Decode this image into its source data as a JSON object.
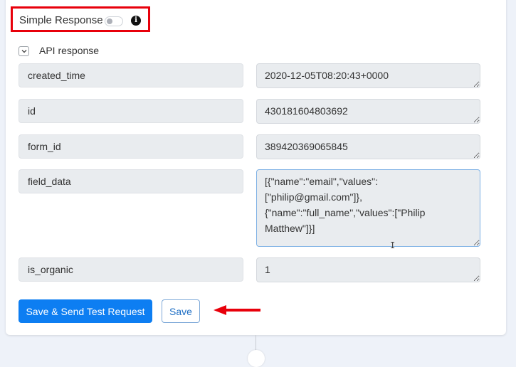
{
  "simple_response": {
    "label": "Simple Response",
    "toggle_on": false,
    "info_icon": "info-circle-icon"
  },
  "api_response": {
    "label": "API response",
    "expanded": true,
    "fields": [
      {
        "key": "created_time",
        "value": "2020-12-05T08:20:43+0000"
      },
      {
        "key": "id",
        "value": "430181604803692"
      },
      {
        "key": "form_id",
        "value": "389420369065845"
      },
      {
        "key": "field_data",
        "value": "[{\"name\":\"email\",\"values\":[\"philip@gmail.com\"]},{\"name\":\"full_name\",\"values\":[\"Philip Matthew\"]}]"
      },
      {
        "key": "is_organic",
        "value": "1"
      }
    ]
  },
  "buttons": {
    "save_send": "Save & Send Test Request",
    "save": "Save"
  },
  "colors": {
    "primary": "#0d7ef2",
    "annotation": "#e8000b"
  }
}
